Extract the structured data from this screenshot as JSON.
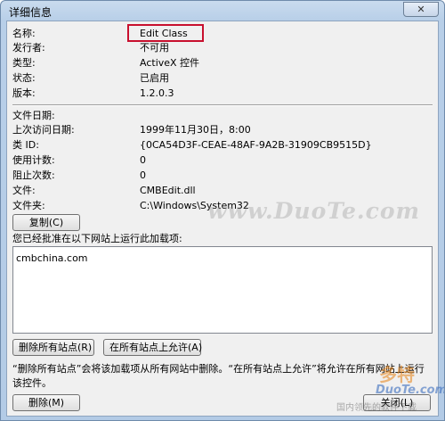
{
  "window": {
    "title": "详细信息",
    "close_label": "✕"
  },
  "properties": [
    {
      "label": "名称:",
      "value": "Edit Class"
    },
    {
      "label": "发行者:",
      "value": "不可用"
    },
    {
      "label": "类型:",
      "value": "ActiveX 控件"
    },
    {
      "label": "状态:",
      "value": "已启用"
    },
    {
      "label": "版本:",
      "value": "1.2.0.3"
    }
  ],
  "file_info": [
    {
      "label": "文件日期:",
      "value": ""
    },
    {
      "label": "上次访问日期:",
      "value": "1999年11月30日，8:00"
    },
    {
      "label": "类 ID:",
      "value": "{0CA54D3F-CEAE-48AF-9A2B-31909CB9515D}"
    },
    {
      "label": "使用计数:",
      "value": "0"
    },
    {
      "label": "阻止次数:",
      "value": "0"
    },
    {
      "label": "文件:",
      "value": "CMBEdit.dll"
    },
    {
      "label": "文件夹:",
      "value": "C:\\Windows\\System32"
    }
  ],
  "copy_button": "复制(C)",
  "sites": {
    "label": "您已经批准在以下网站上运行此加载项:",
    "items": [
      "cmbchina.com"
    ]
  },
  "buttons": {
    "delete_all_sites": "删除所有站点(R)",
    "allow_all_sites": "在所有站点上允许(A)",
    "delete": "删除(M)",
    "close": "关闭(L)"
  },
  "note": "“删除所有站点”会将该加载项从所有网站中删除。“在所有站点上允许”将允许在所有网站上运行该控件。",
  "watermark": "www.DuoTe.com",
  "logo": {
    "line1": "多特",
    "line2": "DuoTe.com",
    "line3": "国内领先的软件下载"
  }
}
